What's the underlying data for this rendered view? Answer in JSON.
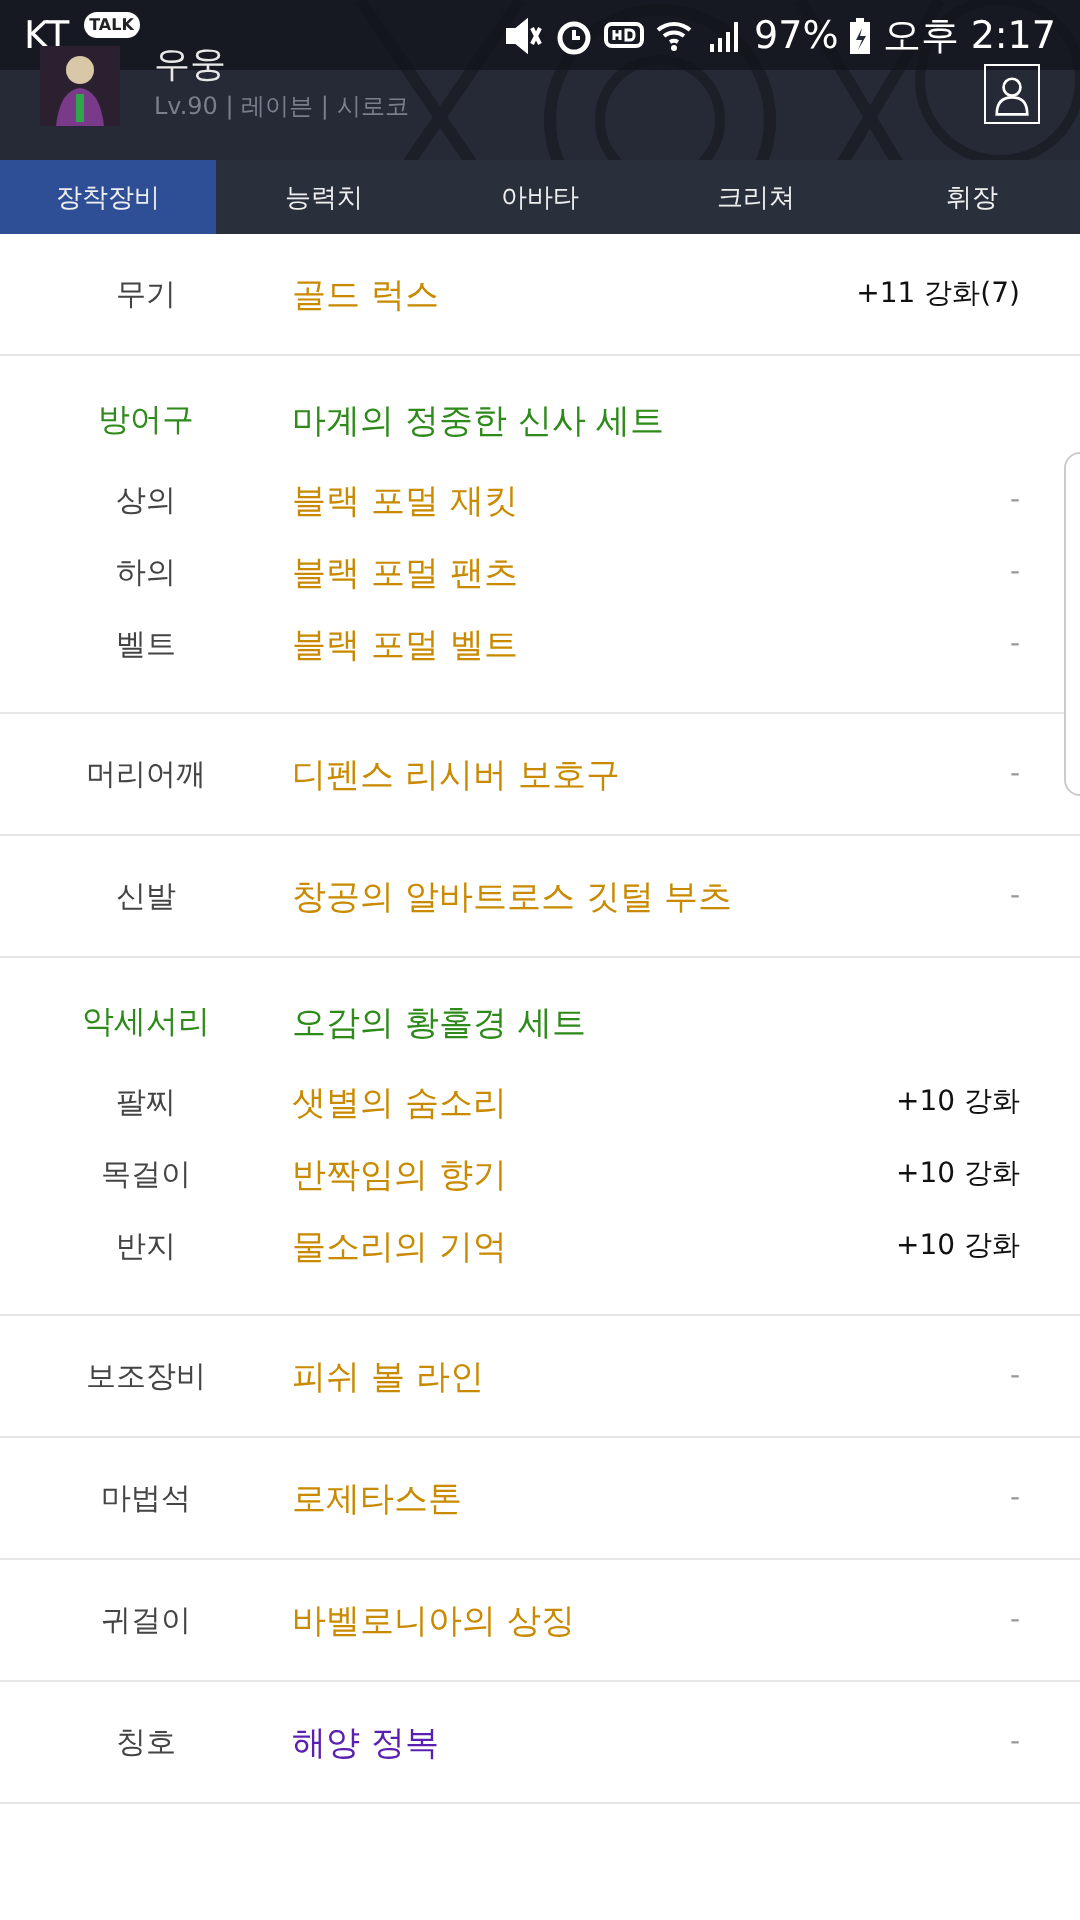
{
  "status_bar": {
    "carrier": "KT",
    "talk_badge": "TALK",
    "battery": "97%",
    "time": "오후 2:17"
  },
  "profile": {
    "name": "우웅",
    "info": "Lv.90 | 레이븐 | 시로코"
  },
  "tabs": [
    {
      "label": "장착장비",
      "selected": true
    },
    {
      "label": "능력치",
      "selected": false
    },
    {
      "label": "아바타",
      "selected": false
    },
    {
      "label": "크리쳐",
      "selected": false
    },
    {
      "label": "휘장",
      "selected": false
    }
  ],
  "sections": [
    {
      "rows": [
        {
          "slot": "무기",
          "item": "골드 럭스",
          "color": "#c98a00",
          "enhance": "+11 강화(7)"
        }
      ]
    },
    {
      "set": {
        "category": "방어구",
        "name": "마계의 정중한 신사 세트"
      },
      "rows": [
        {
          "slot": "상의",
          "item": "블랙 포멀 재킷",
          "color": "#c98a00",
          "enhance": "-"
        },
        {
          "slot": "하의",
          "item": "블랙 포멀 팬츠",
          "color": "#c98a00",
          "enhance": "-"
        },
        {
          "slot": "벨트",
          "item": "블랙 포멀 벨트",
          "color": "#c98a00",
          "enhance": "-"
        }
      ]
    },
    {
      "rows": [
        {
          "slot": "머리어깨",
          "item": "디펜스 리시버 보호구",
          "color": "#c98a00",
          "enhance": "-"
        }
      ]
    },
    {
      "rows": [
        {
          "slot": "신발",
          "item": "창공의 알바트로스 깃털 부츠",
          "color": "#c98a00",
          "enhance": "-"
        }
      ]
    },
    {
      "set": {
        "category": "악세서리",
        "name": "오감의 황홀경 세트"
      },
      "rows": [
        {
          "slot": "팔찌",
          "item": "샛별의 숨소리",
          "color": "#c98a00",
          "enhance": "+10 강화"
        },
        {
          "slot": "목걸이",
          "item": "반짝임의 향기",
          "color": "#c98a00",
          "enhance": "+10 강화"
        },
        {
          "slot": "반지",
          "item": "물소리의 기억",
          "color": "#c98a00",
          "enhance": "+10 강화"
        }
      ]
    },
    {
      "rows": [
        {
          "slot": "보조장비",
          "item": "피쉬 볼 라인",
          "color": "#c98a00",
          "enhance": "-"
        }
      ]
    },
    {
      "rows": [
        {
          "slot": "마법석",
          "item": "로제타스톤",
          "color": "#c98a00",
          "enhance": "-"
        }
      ]
    },
    {
      "rows": [
        {
          "slot": "귀걸이",
          "item": "바벨로니아의 상징",
          "color": "#c98a00",
          "enhance": "-"
        }
      ]
    },
    {
      "rows": [
        {
          "slot": "칭호",
          "item": "해양 정복",
          "color": "#5a1fb0",
          "enhance": "-"
        }
      ]
    }
  ]
}
